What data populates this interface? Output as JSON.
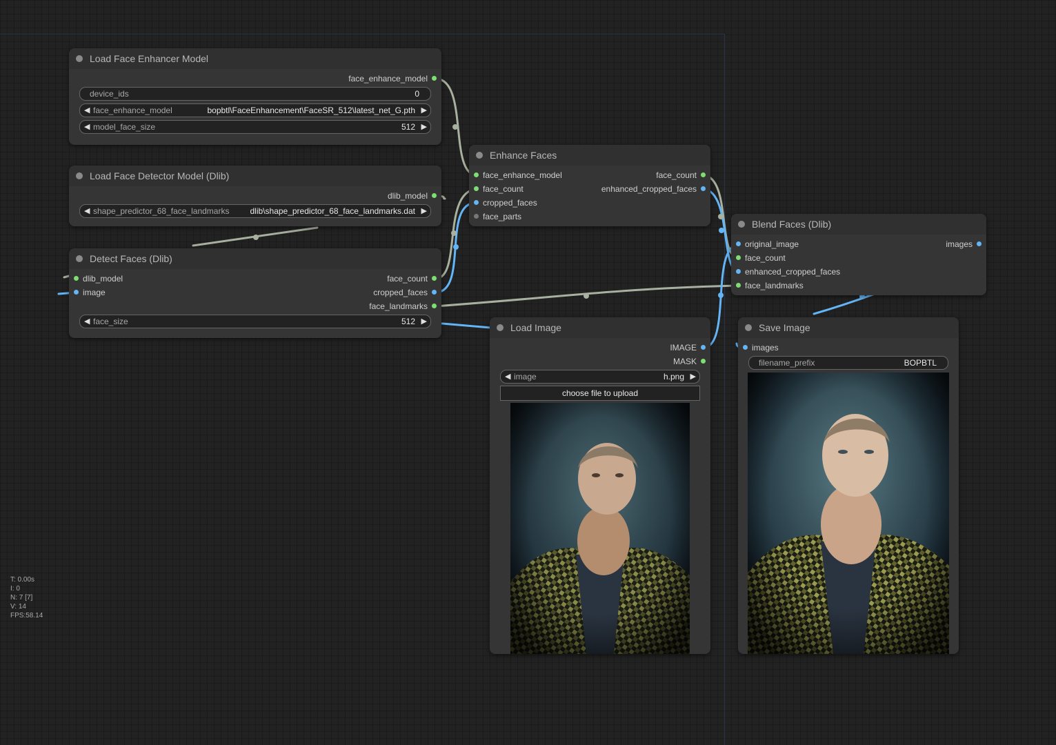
{
  "nodes": {
    "load_enhancer": {
      "title": "Load Face Enhancer Model",
      "outputs": [
        "face_enhance_model"
      ],
      "widgets": {
        "device_ids": {
          "label": "device_ids",
          "value": "0"
        },
        "face_enhance_model": {
          "label": "face_enhance_model",
          "value": "bopbtl\\FaceEnhancement\\FaceSR_512\\latest_net_G.pth"
        },
        "model_face_size": {
          "label": "model_face_size",
          "value": "512"
        }
      }
    },
    "load_detector": {
      "title": "Load Face Detector Model (Dlib)",
      "outputs": [
        "dlib_model"
      ],
      "widgets": {
        "shape_predictor": {
          "label": "shape_predictor_68_face_landmarks",
          "value": "dlib\\shape_predictor_68_face_landmarks.dat"
        }
      }
    },
    "detect_faces": {
      "title": "Detect Faces (Dlib)",
      "inputs": [
        "dlib_model",
        "image"
      ],
      "outputs": [
        "face_count",
        "cropped_faces",
        "face_landmarks"
      ],
      "widgets": {
        "face_size": {
          "label": "face_size",
          "value": "512"
        }
      }
    },
    "enhance_faces": {
      "title": "Enhance Faces",
      "inputs": [
        "face_enhance_model",
        "face_count",
        "cropped_faces",
        "face_parts"
      ],
      "outputs": [
        "face_count",
        "enhanced_cropped_faces"
      ]
    },
    "blend_faces": {
      "title": "Blend Faces (Dlib)",
      "inputs": [
        "original_image",
        "face_count",
        "enhanced_cropped_faces",
        "face_landmarks"
      ],
      "outputs": [
        "images"
      ]
    },
    "load_image": {
      "title": "Load Image",
      "outputs": [
        "IMAGE",
        "MASK"
      ],
      "widgets": {
        "image": {
          "label": "image",
          "value": "h.png"
        }
      },
      "upload_label": "choose file to upload"
    },
    "save_image": {
      "title": "Save Image",
      "inputs": [
        "images"
      ],
      "widgets": {
        "filename_prefix": {
          "label": "filename_prefix",
          "value": "BOPBTL"
        }
      }
    }
  },
  "stats": [
    "T: 0.00s",
    "I: 0",
    "N: 7 [7]",
    "V: 14",
    "FPS:58.14"
  ],
  "colors": {
    "canvas": "#222222",
    "node_body": "#353535",
    "node_title": "#303030",
    "slot_green": "#7ddf71",
    "slot_blue": "#64b5f6",
    "link_model": "#a8b0a0",
    "link_image": "#64b5f6"
  }
}
